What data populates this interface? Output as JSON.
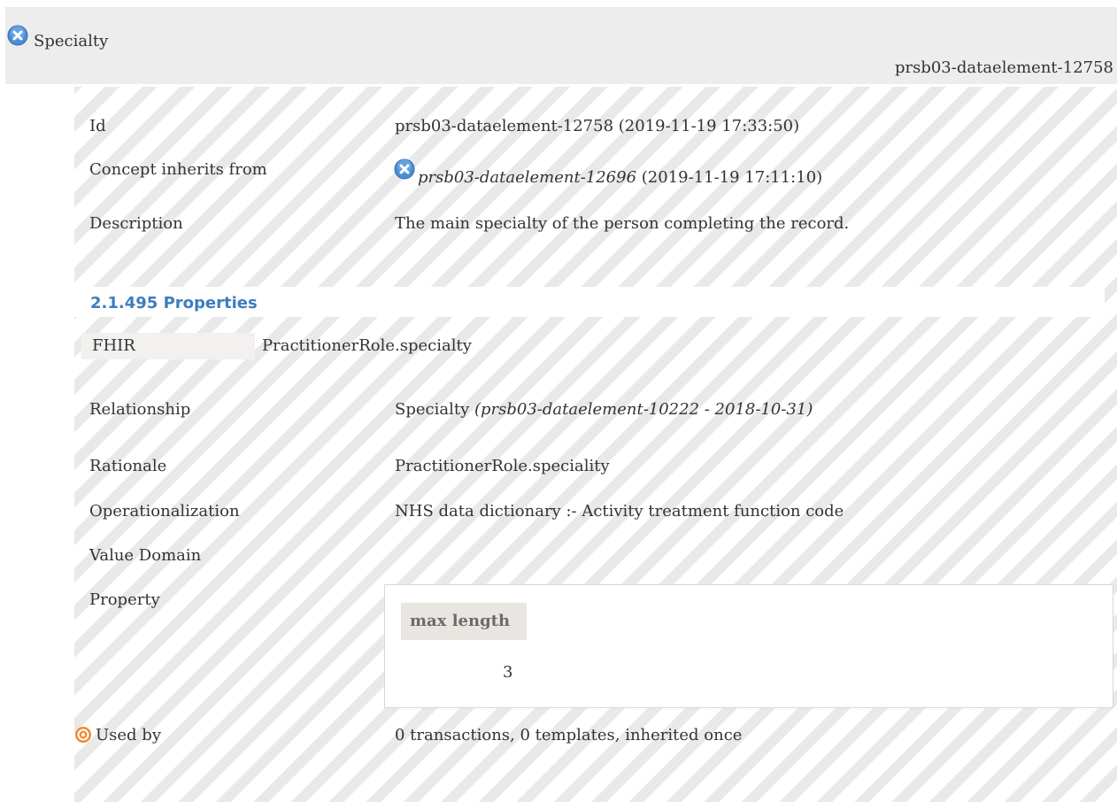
{
  "header": {
    "title": "Specialty",
    "id": "prsb03-dataelement-12758"
  },
  "rows": {
    "id": {
      "label": "Id",
      "value": "prsb03-dataelement-12758 (2019-11-19 17:33:50)"
    },
    "inherits": {
      "label": "Concept inherits from",
      "link": "prsb03-dataelement-12696",
      "date": "(2019-11-19 17:11:10)"
    },
    "description": {
      "label": "Description",
      "value": "The main specialty of the person completing the record."
    }
  },
  "properties": {
    "title": "2.1.495 Properties",
    "fhir_key": "FHIR",
    "fhir_value": "PractitionerRole.specialty",
    "relationship": {
      "label": "Relationship",
      "value": "Specialty",
      "ref": "(prsb03-dataelement-10222 - 2018-10-31)"
    },
    "rationale": {
      "label": "Rationale",
      "value": "PractitionerRole.speciality"
    },
    "operationalization": {
      "label": "Operationalization",
      "value": "NHS data dictionary :- Activity treatment function code"
    },
    "value_domain": {
      "label": "Value Domain"
    },
    "property": {
      "label": "Property",
      "header": "max length",
      "value": "3"
    },
    "used_by": {
      "label": "Used by",
      "value": "0 transactions, 0 templates, inherited once"
    }
  },
  "colors": {
    "icon_blue": "#4a8fd6",
    "section_title": "#3d7dbf",
    "used_by_icon": "#f08a2c"
  }
}
